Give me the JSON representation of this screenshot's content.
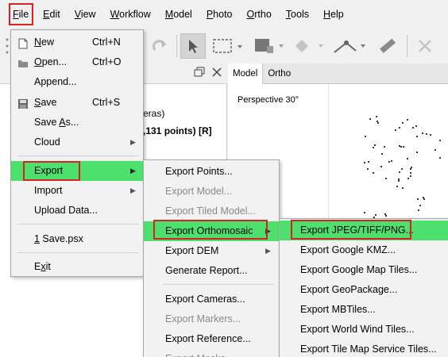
{
  "menubar": {
    "items": [
      {
        "pre": "",
        "mnem": "F",
        "post": "ile"
      },
      {
        "pre": "",
        "mnem": "E",
        "post": "dit"
      },
      {
        "pre": "",
        "mnem": "V",
        "post": "iew"
      },
      {
        "pre": "",
        "mnem": "W",
        "post": "orkflow"
      },
      {
        "pre": "",
        "mnem": "M",
        "post": "odel"
      },
      {
        "pre": "",
        "mnem": "P",
        "post": "hoto"
      },
      {
        "pre": "",
        "mnem": "O",
        "post": "rtho"
      },
      {
        "pre": "",
        "mnem": "T",
        "post": "ools"
      },
      {
        "pre": "",
        "mnem": "H",
        "post": "elp"
      }
    ]
  },
  "left_panel": {
    "fragment_1": "eras)",
    "fragment_2": ",131 points) [R]"
  },
  "view": {
    "tabs": [
      "Model",
      "Ortho"
    ],
    "perspective_label": "Perspective 30°"
  },
  "file_menu": {
    "items": [
      {
        "pre": "",
        "mnem": "N",
        "post": "ew",
        "shortcut": "Ctrl+N",
        "icon": "new-file-icon"
      },
      {
        "pre": "",
        "mnem": "O",
        "post": "pen...",
        "shortcut": "Ctrl+O",
        "icon": "open-folder-icon"
      },
      {
        "pre": "Append...",
        "mnem": "",
        "post": "",
        "shortcut": ""
      },
      {
        "pre": "",
        "mnem": "S",
        "post": "ave",
        "shortcut": "Ctrl+S",
        "icon": "save-disk-icon"
      },
      {
        "pre": "Save ",
        "mnem": "A",
        "post": "s...",
        "shortcut": ""
      },
      {
        "pre": "Cloud",
        "mnem": "",
        "post": "",
        "shortcut": ""
      },
      {
        "pre": "Export",
        "mnem": "",
        "post": "",
        "shortcut": ""
      },
      {
        "pre": "Import",
        "mnem": "",
        "post": "",
        "shortcut": ""
      },
      {
        "pre": "Upload Data...",
        "mnem": "",
        "post": "",
        "shortcut": ""
      },
      {
        "pre": "",
        "mnem": "1",
        "post": " Save.psx",
        "shortcut": ""
      },
      {
        "pre": "E",
        "mnem": "x",
        "post": "it",
        "shortcut": ""
      }
    ]
  },
  "export_menu": {
    "items": [
      "Export Points...",
      "Export Model...",
      "Export Tiled Model...",
      "Export Orthomosaic",
      "Export DEM",
      "Generate Report...",
      "Export Cameras...",
      "Export Markers...",
      "Export Reference...",
      "Export Masks..."
    ]
  },
  "ortho_menu": {
    "items": [
      "Export JPEG/TIFF/PNG...",
      "Export Google KMZ...",
      "Export Google Map Tiles...",
      "Export GeoPackage...",
      "Export MBTiles...",
      "Export World Wind Tiles...",
      "Export Tile Map Service Tiles..."
    ]
  },
  "colors": {
    "highlight": "#4ee06d",
    "annotation_box": "#d42323"
  }
}
